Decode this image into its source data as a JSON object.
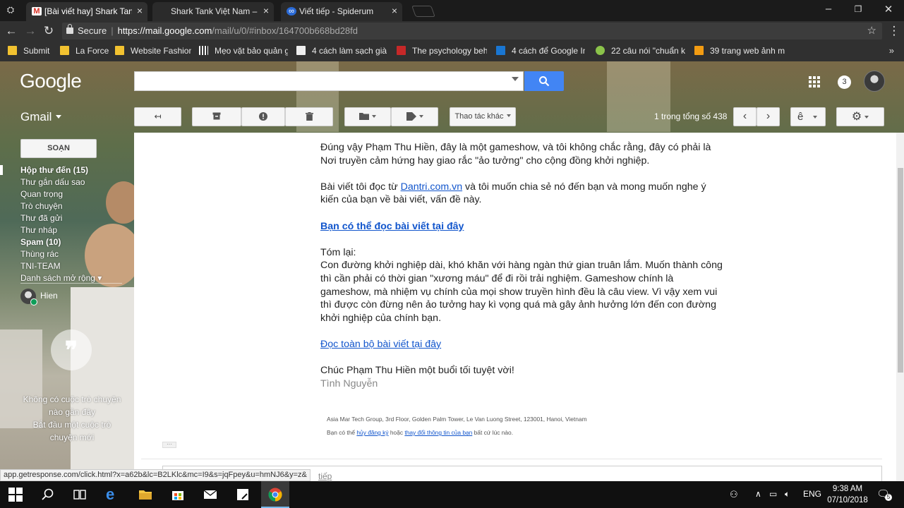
{
  "browser": {
    "tabs": [
      {
        "title": "[Bài viết hay] Shark Tank V",
        "favicon": "gmail-icon",
        "active": true
      },
      {
        "title": "Shark Tank Việt Nam – N",
        "favicon": "page-icon",
        "active": false
      },
      {
        "title": "Viết tiếp - Spiderum",
        "favicon": "spiderum-icon",
        "active": false
      }
    ],
    "window_controls": {
      "minimize": "–",
      "maximize": "❐",
      "close": "✕"
    },
    "address": {
      "secure_label": "Secure",
      "url_host": "https://mail.google.com",
      "url_path": "/mail/u/0/#inbox/164700b668bd28fd"
    },
    "bookmarks": [
      {
        "label": "Submit",
        "icon": "folder-icon"
      },
      {
        "label": "La Force",
        "icon": "folder-icon"
      },
      {
        "label": "Website Fashion",
        "icon": "folder-icon"
      },
      {
        "label": "Mẹo vặt bảo quản g",
        "icon": "piano-icon"
      },
      {
        "label": "4 cách làm sạch giày",
        "icon": "shoe-icon"
      },
      {
        "label": "The psychology beh",
        "icon": "psychology-icon"
      },
      {
        "label": "4 cách để Google Inc",
        "icon": "info-icon"
      },
      {
        "label": "22 câu nói \"chuẩn k",
        "icon": "check-icon"
      },
      {
        "label": "39 trang web ảnh m",
        "icon": "folder-orange-icon"
      }
    ],
    "bookmarks_more": "»"
  },
  "gmail": {
    "logo": "Google",
    "product": "Gmail",
    "notifications": "3",
    "toolbar": {
      "more_actions": "Thao tác khác",
      "pager": "1 trong tổng số 438",
      "input_tool": "ê"
    },
    "compose": "SOẠN",
    "nav": [
      {
        "label": "Hộp thư đến (15)",
        "bold": true
      },
      {
        "label": "Thư gắn dấu sao",
        "bold": false
      },
      {
        "label": "Quan trọng",
        "bold": false
      },
      {
        "label": "Trò chuyện",
        "bold": false
      },
      {
        "label": "Thư đã gửi",
        "bold": false
      },
      {
        "label": "Thư nháp",
        "bold": false
      },
      {
        "label": "Spam (10)",
        "bold": true
      },
      {
        "label": "Thùng rác",
        "bold": false
      },
      {
        "label": "TNI-TEAM",
        "bold": false
      },
      {
        "label": "Danh sách mở rộng ▾",
        "bold": false
      }
    ],
    "user_name": "Hien",
    "chat_empty_1": "Không có cuộc trò chuyện nào gần đây",
    "chat_empty_2": "Bắt đầu một cuộc trò chuyện mới"
  },
  "email": {
    "p1": "Đúng vậy Phạm Thu Hiền, đây là một gameshow, và tôi không chắc rằng, đây có phải là Nơi truyền cảm hứng hay giao rắc \"ảo tưởng\" cho cộng đồng khởi nghiệp.",
    "p2_before": "Bài viết tôi đọc từ ",
    "p2_link": "Dantri.com.vn",
    "p2_after": " và tôi muốn chia sẻ nó đến bạn và mong muốn nghe ý kiến của bạn về bài viết, vấn đề này.",
    "read_here": "Bạn có thể đọc bài viết tại đây",
    "summary_label": "Tóm lại:",
    "summary": "Con đường khởi nghiệp dài, khó khăn với hàng ngàn thứ gian truân lắm. Muốn thành công thì cần phải có thời gian \"xương máu\" để đi rồi trải nghiệm. Gameshow chính là gameshow, mà nhiệm vụ chính của mọi show truyền hình đều là câu view. Vì vậy xem vui thì được còn đừng nên ảo tưởng hay kì vọng quá mà gây ảnh hưởng lớn đến con đường khởi nghiệp của chính bạn.",
    "read_full": "Đọc toàn bộ bài viết tại đây",
    "closing": "Chúc Phạm Thu Hiền một buổi tối tuyệt vời!",
    "signature": "Tình Nguyễn",
    "footer_address": "Asia Mar Tech Group, 3rd Floor, Golden Palm Tower, Le Van Luong Street, 123001, Hanoi, Vietnam",
    "footer_prefix": "Bạn có thể ",
    "footer_unsub": "hủy đăng ký",
    "footer_mid": " hoặc ",
    "footer_change": "thay đổi thông tin của bạn",
    "footer_suffix": " bất cứ lúc nào.",
    "ellipsis": "···",
    "reply_partial": "tiếp"
  },
  "status_url": "app.getresponse.com/click.html?x=a62b&lc=B2LKlc&mc=I9&s=jqFpey&u=hmNJ6&y=z&",
  "taskbar": {
    "language": "ENG",
    "time": "9:38 AM",
    "date": "07/10/2018",
    "notification_count": "5"
  },
  "colors": {
    "chrome_dark": "#303030",
    "gmail_blue": "#4285f4",
    "link": "#1155cc",
    "taskbar": "#101010"
  }
}
